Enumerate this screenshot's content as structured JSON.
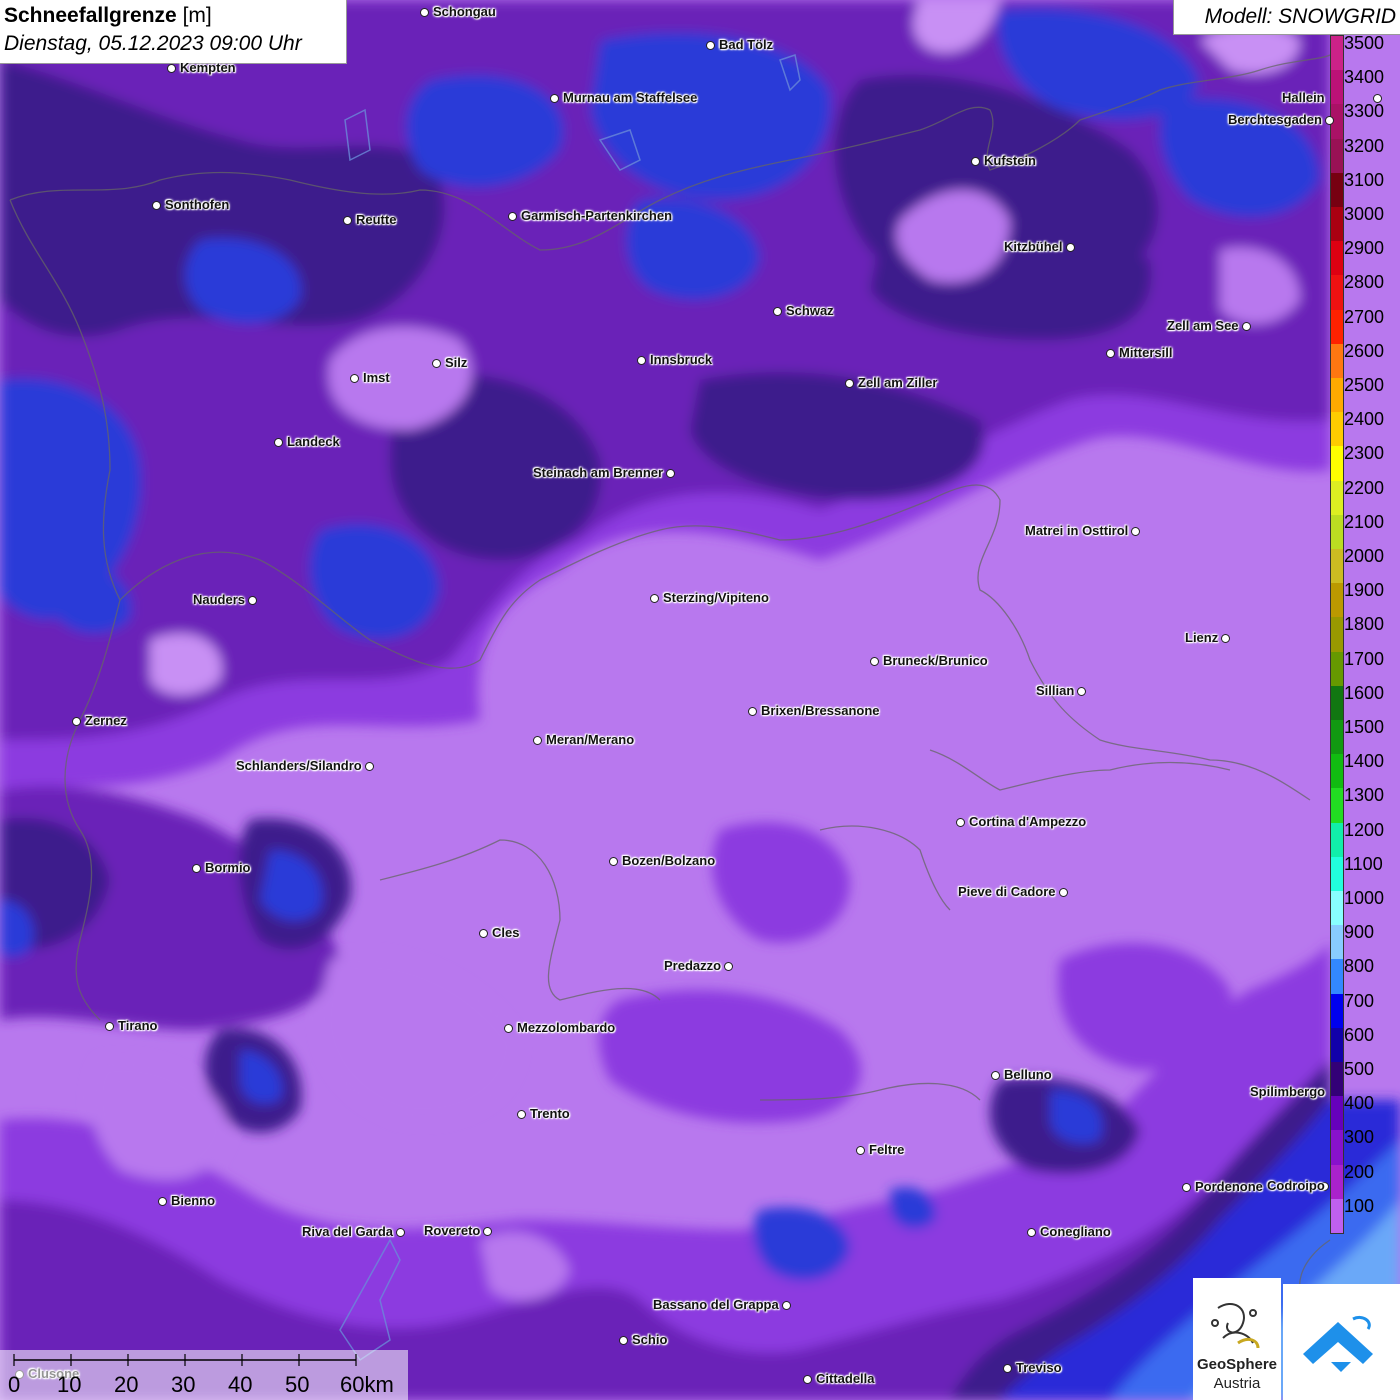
{
  "title": {
    "parameter": "Schneefallgrenze",
    "unit": "[m]",
    "datetime": "Dienstag, 05.12.2023 09:00 Uhr"
  },
  "model": {
    "label": "Modell: SNOWGRID"
  },
  "legend": {
    "values": [
      "3500",
      "3400",
      "3300",
      "3200",
      "3100",
      "3000",
      "2900",
      "2800",
      "2700",
      "2600",
      "2500",
      "2400",
      "2300",
      "2200",
      "2100",
      "2000",
      "1900",
      "1800",
      "1700",
      "1600",
      "1500",
      "1400",
      "1300",
      "1200",
      "1100",
      "1000",
      "900",
      "800",
      "700",
      "600",
      "500",
      "400",
      "300",
      "200",
      "100"
    ],
    "colors": [
      "#cc2288",
      "#bb1177",
      "#aa1166",
      "#991155",
      "#770011",
      "#aa0011",
      "#dd0011",
      "#ee1111",
      "#ff2200",
      "#ff7711",
      "#ffaa00",
      "#ffcc00",
      "#ffff00",
      "#ddee22",
      "#bbdd22",
      "#ccbb22",
      "#bb9900",
      "#999900",
      "#669900",
      "#117711",
      "#119911",
      "#11bb11",
      "#22dd22",
      "#11eeaa",
      "#22ffdd",
      "#88ffff",
      "#88ccff",
      "#3388ff",
      "#0000ee",
      "#1100aa",
      "#330077",
      "#6600bb",
      "#8811cc",
      "#aa22cc",
      "#c060ee"
    ]
  },
  "cities": [
    {
      "name": "Schongau"
    },
    {
      "name": "Bad Tölz"
    },
    {
      "name": "Kempten"
    },
    {
      "name": "Murnau am Staffelsee"
    },
    {
      "name": "Hallein"
    },
    {
      "name": "Berchtesgaden"
    },
    {
      "name": "Kufstein"
    },
    {
      "name": "Sonthofen"
    },
    {
      "name": "Reutte"
    },
    {
      "name": "Garmisch-Partenkirchen"
    },
    {
      "name": "Kitzbühel"
    },
    {
      "name": "Schwaz"
    },
    {
      "name": "Zell am See"
    },
    {
      "name": "Innsbruck"
    },
    {
      "name": "Mittersill"
    },
    {
      "name": "Imst"
    },
    {
      "name": "Silz"
    },
    {
      "name": "Zell am Ziller"
    },
    {
      "name": "Landeck"
    },
    {
      "name": "Steinach am Brenner"
    },
    {
      "name": "Matrei in Osttirol"
    },
    {
      "name": "Nauders"
    },
    {
      "name": "Sterzing/Vipiteno"
    },
    {
      "name": "Lienz"
    },
    {
      "name": "Bruneck/Brunico"
    },
    {
      "name": "Sillian"
    },
    {
      "name": "Zernez"
    },
    {
      "name": "Brixen/Bressanone"
    },
    {
      "name": "Meran/Merano"
    },
    {
      "name": "Schlanders/Silandro"
    },
    {
      "name": "Cortina d'Ampezzo"
    },
    {
      "name": "Bormio"
    },
    {
      "name": "Bozen/Bolzano"
    },
    {
      "name": "Pieve di Cadore"
    },
    {
      "name": "Cles"
    },
    {
      "name": "Predazzo"
    },
    {
      "name": "Tirano"
    },
    {
      "name": "Mezzolombardo"
    },
    {
      "name": "Belluno"
    },
    {
      "name": "Spilimbergo"
    },
    {
      "name": "Trento"
    },
    {
      "name": "Feltre"
    },
    {
      "name": "Pordenone"
    },
    {
      "name": "Codroipo"
    },
    {
      "name": "Bienno"
    },
    {
      "name": "Riva del Garda"
    },
    {
      "name": "Rovereto"
    },
    {
      "name": "Conegliano"
    },
    {
      "name": "Bassano del Grappa"
    },
    {
      "name": "Schio"
    },
    {
      "name": "Treviso"
    },
    {
      "name": "Cittadella"
    },
    {
      "name": "Clusone"
    }
  ],
  "scale": {
    "ticks": [
      "0",
      "10",
      "20",
      "30",
      "40",
      "50",
      "60km"
    ]
  },
  "logo": {
    "name": "GeoSphere",
    "sub": "Austria"
  }
}
